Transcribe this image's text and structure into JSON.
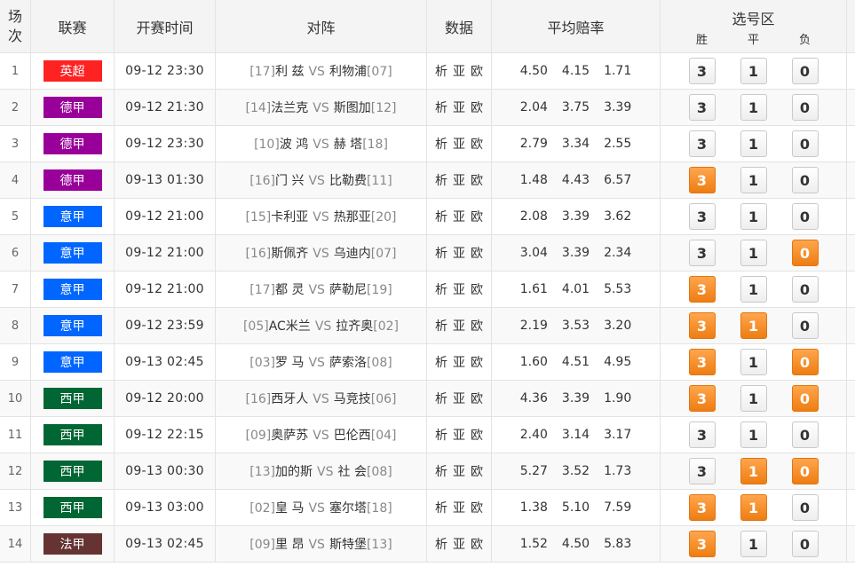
{
  "header": {
    "idx_line1": "场",
    "idx_line2": "次",
    "league": "联赛",
    "time": "开赛时间",
    "match": "对阵",
    "data": "数据",
    "odds": "平均赔率",
    "select": "选号区",
    "win": "胜",
    "draw": "平",
    "loss": "负"
  },
  "vs_label": "VS",
  "data_links": [
    "析",
    "亚",
    "欧"
  ],
  "pick_labels": [
    "3",
    "1",
    "0"
  ],
  "league_colors": {
    "英超": "#ff2222",
    "德甲": "#990099",
    "意甲": "#0066ff",
    "西甲": "#006633",
    "法甲": "#663333"
  },
  "selected_color": "#f08518",
  "matches": [
    {
      "idx": "1",
      "league": "英超",
      "time": "09-12 23:30",
      "home_rank": "[17]",
      "home": "利 兹",
      "away": "利物浦",
      "away_rank": "[07]",
      "odds": [
        "4.50",
        "4.15",
        "1.71"
      ],
      "selected": [
        false,
        false,
        false
      ]
    },
    {
      "idx": "2",
      "league": "德甲",
      "time": "09-12 21:30",
      "home_rank": "[14]",
      "home": "法兰克",
      "away": "斯图加",
      "away_rank": "[12]",
      "odds": [
        "2.04",
        "3.75",
        "3.39"
      ],
      "selected": [
        false,
        false,
        false
      ]
    },
    {
      "idx": "3",
      "league": "德甲",
      "time": "09-12 23:30",
      "home_rank": "[10]",
      "home": "波 鸿",
      "away": "赫 塔",
      "away_rank": "[18]",
      "odds": [
        "2.79",
        "3.34",
        "2.55"
      ],
      "selected": [
        false,
        false,
        false
      ]
    },
    {
      "idx": "4",
      "league": "德甲",
      "time": "09-13 01:30",
      "home_rank": "[16]",
      "home": "门 兴",
      "away": "比勒费",
      "away_rank": "[11]",
      "odds": [
        "1.48",
        "4.43",
        "6.57"
      ],
      "selected": [
        true,
        false,
        false
      ]
    },
    {
      "idx": "5",
      "league": "意甲",
      "time": "09-12 21:00",
      "home_rank": "[15]",
      "home": "卡利亚",
      "away": "热那亚",
      "away_rank": "[20]",
      "odds": [
        "2.08",
        "3.39",
        "3.62"
      ],
      "selected": [
        false,
        false,
        false
      ]
    },
    {
      "idx": "6",
      "league": "意甲",
      "time": "09-12 21:00",
      "home_rank": "[16]",
      "home": "斯佩齐",
      "away": "乌迪内",
      "away_rank": "[07]",
      "odds": [
        "3.04",
        "3.39",
        "2.34"
      ],
      "selected": [
        false,
        false,
        true
      ]
    },
    {
      "idx": "7",
      "league": "意甲",
      "time": "09-12 21:00",
      "home_rank": "[17]",
      "home": "都 灵",
      "away": "萨勒尼",
      "away_rank": "[19]",
      "odds": [
        "1.61",
        "4.01",
        "5.53"
      ],
      "selected": [
        true,
        false,
        false
      ]
    },
    {
      "idx": "8",
      "league": "意甲",
      "time": "09-12 23:59",
      "home_rank": "[05]",
      "home": "AC米兰",
      "away": "拉齐奥",
      "away_rank": "[02]",
      "odds": [
        "2.19",
        "3.53",
        "3.20"
      ],
      "selected": [
        true,
        true,
        false
      ]
    },
    {
      "idx": "9",
      "league": "意甲",
      "time": "09-13 02:45",
      "home_rank": "[03]",
      "home": "罗 马",
      "away": "萨索洛",
      "away_rank": "[08]",
      "odds": [
        "1.60",
        "4.51",
        "4.95"
      ],
      "selected": [
        true,
        false,
        true
      ]
    },
    {
      "idx": "10",
      "league": "西甲",
      "time": "09-12 20:00",
      "home_rank": "[16]",
      "home": "西牙人",
      "away": "马竞技",
      "away_rank": "[06]",
      "odds": [
        "4.36",
        "3.39",
        "1.90"
      ],
      "selected": [
        true,
        false,
        true
      ]
    },
    {
      "idx": "11",
      "league": "西甲",
      "time": "09-12 22:15",
      "home_rank": "[09]",
      "home": "奥萨苏",
      "away": "巴伦西",
      "away_rank": "[04]",
      "odds": [
        "2.40",
        "3.14",
        "3.17"
      ],
      "selected": [
        false,
        false,
        false
      ]
    },
    {
      "idx": "12",
      "league": "西甲",
      "time": "09-13 00:30",
      "home_rank": "[13]",
      "home": "加的斯",
      "away": "社 会",
      "away_rank": "[08]",
      "odds": [
        "5.27",
        "3.52",
        "1.73"
      ],
      "selected": [
        false,
        true,
        true
      ]
    },
    {
      "idx": "13",
      "league": "西甲",
      "time": "09-13 03:00",
      "home_rank": "[02]",
      "home": "皇 马",
      "away": "塞尔塔",
      "away_rank": "[18]",
      "odds": [
        "1.38",
        "5.10",
        "7.59"
      ],
      "selected": [
        true,
        true,
        false
      ]
    },
    {
      "idx": "14",
      "league": "法甲",
      "time": "09-13 02:45",
      "home_rank": "[09]",
      "home": "里 昂",
      "away": "斯特堡",
      "away_rank": "[13]",
      "odds": [
        "1.52",
        "4.50",
        "5.83"
      ],
      "selected": [
        true,
        false,
        false
      ]
    }
  ]
}
